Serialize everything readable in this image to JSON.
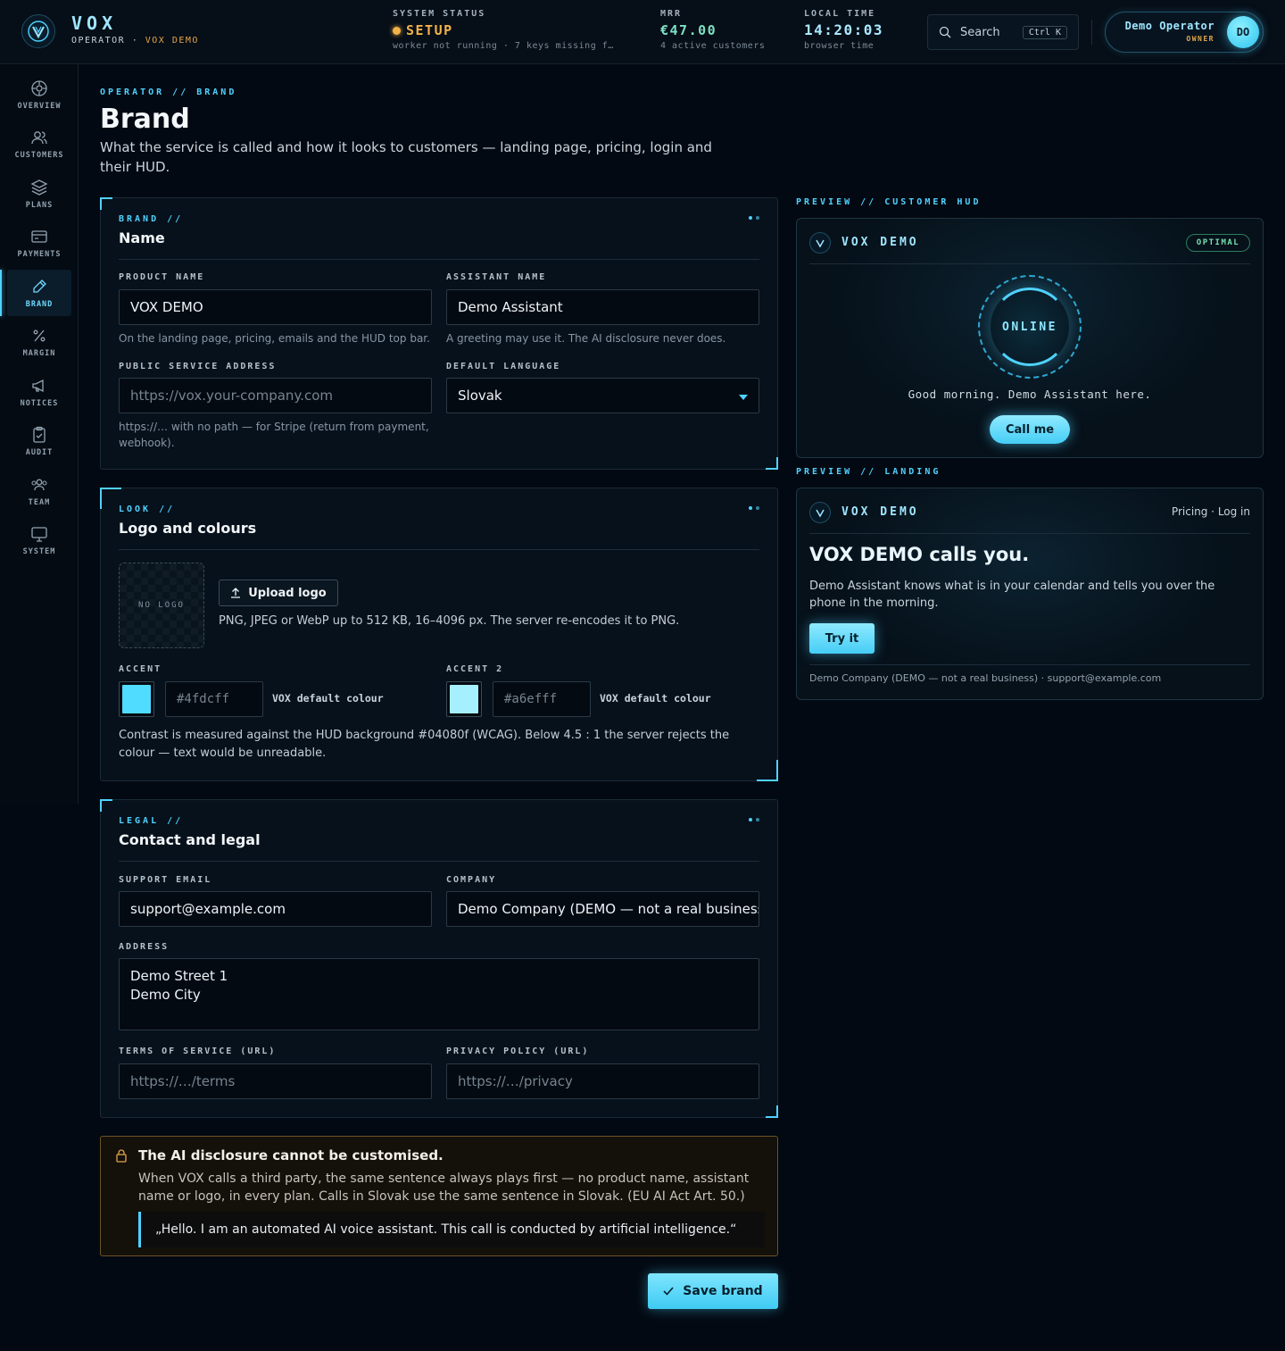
{
  "app": {
    "name": "VOX",
    "role": "OPERATOR",
    "separator": "·",
    "tenant": "VOX DEMO"
  },
  "topbar": {
    "status": {
      "label": "SYSTEM STATUS",
      "value": "SETUP",
      "sub": "worker not running · 7 keys missing f…",
      "color": "#f1b24a"
    },
    "mrr": {
      "label": "MRR",
      "value": "€47.00",
      "sub": "4 active customers"
    },
    "time": {
      "label": "LOCAL TIME",
      "value": "14:20:03",
      "sub": "browser time"
    },
    "search": {
      "label": "Search",
      "shortcut": "Ctrl K"
    },
    "user": {
      "name": "Demo Operator",
      "role": "OWNER",
      "initials": "DO"
    }
  },
  "sidebar": {
    "items": [
      {
        "label": "OVERVIEW",
        "icon": "crosshair-icon"
      },
      {
        "label": "CUSTOMERS",
        "icon": "users-icon"
      },
      {
        "label": "PLANS",
        "icon": "layers-icon"
      },
      {
        "label": "PAYMENTS",
        "icon": "credit-card-icon"
      },
      {
        "label": "BRAND",
        "icon": "pen-icon",
        "active": true
      },
      {
        "label": "MARGIN",
        "icon": "percent-icon"
      },
      {
        "label": "NOTICES",
        "icon": "megaphone-icon"
      },
      {
        "label": "AUDIT",
        "icon": "clipboard-icon"
      },
      {
        "label": "TEAM",
        "icon": "team-icon"
      },
      {
        "label": "SYSTEM",
        "icon": "monitor-icon"
      }
    ]
  },
  "page": {
    "breadcrumb": "OPERATOR // BRAND",
    "title": "Brand",
    "lead": "What the service is called and how it looks to customers — landing page, pricing, login and their HUD."
  },
  "name_card": {
    "eyebrow": "BRAND //",
    "title": "Name",
    "product_name": {
      "label": "PRODUCT NAME",
      "value": "VOX DEMO",
      "hint": "On the landing page, pricing, emails and the HUD top bar."
    },
    "assistant_name": {
      "label": "ASSISTANT NAME",
      "value": "Demo Assistant",
      "hint": "A greeting may use it. The AI disclosure never does."
    },
    "public_address": {
      "label": "PUBLIC SERVICE ADDRESS",
      "placeholder": "https://vox.your-company.com",
      "hint": "https://… with no path — for Stripe (return from payment, webhook)."
    },
    "language": {
      "label": "DEFAULT LANGUAGE",
      "value": "Slovak"
    }
  },
  "look_card": {
    "eyebrow": "LOOK //",
    "title": "Logo and colours",
    "no_logo": "NO LOGO",
    "upload_label": "Upload logo",
    "upload_hint": "PNG, JPEG or WebP up to 512 KB, 16–4096 px. The server re-encodes it to PNG.",
    "accent": {
      "label": "ACCENT",
      "placeholder": "#4fdcff",
      "color": "#4fdcff",
      "default_label": "VOX default colour"
    },
    "accent2": {
      "label": "ACCENT 2",
      "placeholder": "#a6efff",
      "color": "#a6efff",
      "default_label": "VOX default colour"
    },
    "contrast_note": "Contrast is measured against the HUD background #04080f (WCAG). Below 4.5 : 1 the server rejects the colour — text would be unreadable."
  },
  "legal_card": {
    "eyebrow": "LEGAL //",
    "title": "Contact and legal",
    "support_email": {
      "label": "SUPPORT EMAIL",
      "value": "support@example.com"
    },
    "company": {
      "label": "COMPANY",
      "value": "Demo Company (DEMO — not a real business)"
    },
    "address": {
      "label": "ADDRESS",
      "value": "Demo Street 1\nDemo City"
    },
    "terms": {
      "label": "TERMS OF SERVICE (URL)",
      "placeholder": "https://…/terms"
    },
    "privacy": {
      "label": "PRIVACY POLICY (URL)",
      "placeholder": "https://…/privacy"
    }
  },
  "disclosure": {
    "title": "The AI disclosure cannot be customised.",
    "body": "When VOX calls a third party, the same sentence always plays first — no product name, assistant name or logo, in every plan. Calls in Slovak use the same sentence in Slovak. (EU AI Act Art. 50.)",
    "quote": "„Hello. I am an automated AI voice assistant. This call is conducted by artificial intelligence.“"
  },
  "save_label": "Save brand",
  "preview_hud": {
    "label": "PREVIEW // CUSTOMER HUD",
    "name": "VOX DEMO",
    "badge": "OPTIMAL",
    "ring_text": "ONLINE",
    "greeting": "Good morning. Demo Assistant here.",
    "call_label": "Call me"
  },
  "preview_landing": {
    "label": "PREVIEW // LANDING",
    "name": "VOX DEMO",
    "nav": "Pricing · Log in",
    "headline": "VOX DEMO calls you.",
    "body": "Demo Assistant knows what is in your calendar and tells you over the phone in the morning.",
    "cta": "Try it",
    "footer": "Demo Company (DEMO — not a real business) · support@example.com"
  }
}
